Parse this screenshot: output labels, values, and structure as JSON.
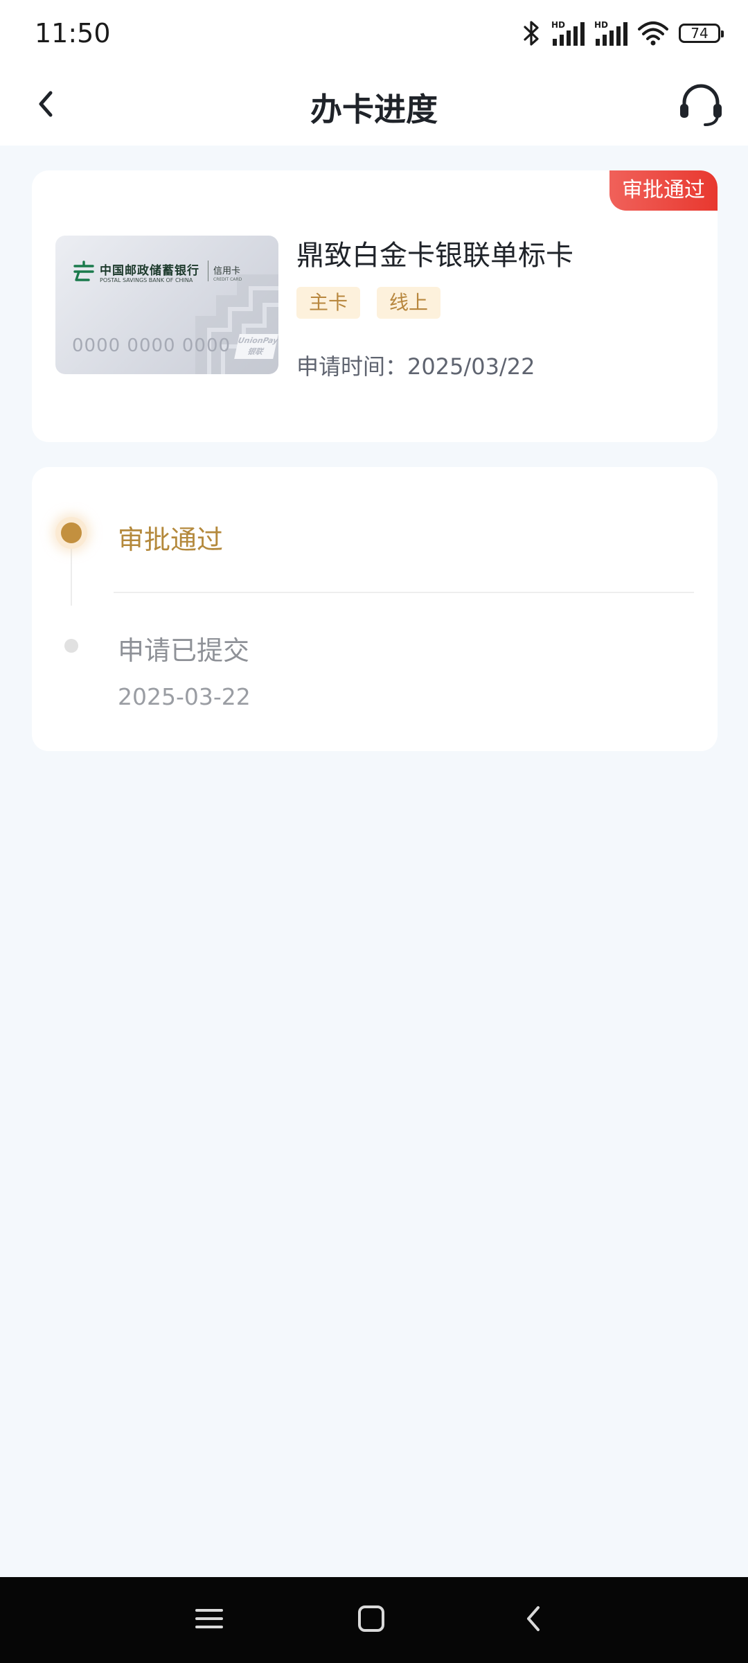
{
  "status_bar": {
    "time": "11:50",
    "battery": "74",
    "icons": [
      "bluetooth-icon",
      "hd-signal-icon",
      "hd-signal-icon",
      "wifi-icon",
      "battery-icon"
    ]
  },
  "header": {
    "title": "办卡进度",
    "back_icon": "chevron-left-icon",
    "service_icon": "headset-icon"
  },
  "card": {
    "status_badge": "审批通过",
    "image": {
      "bank_name": "中国邮政储蓄银行",
      "bank_name_en": "POSTAL SAVINGS BANK OF CHINA",
      "card_type": "信用卡",
      "card_type_en": "CREDIT CARD",
      "number": "0000 0000 0000",
      "network_logo": "UnionPay 银联"
    },
    "name": "鼎致白金卡银联单标卡",
    "tags": [
      "主卡",
      "线上"
    ],
    "apply_time": "申请时间：2025/03/22"
  },
  "progress": {
    "steps": [
      {
        "title": "审批通过",
        "date": "",
        "active": true
      },
      {
        "title": "申请已提交",
        "date": "2025-03-22",
        "active": false
      }
    ]
  },
  "colors": {
    "accent_gold": "#b4893c",
    "badge_red": "#e8382f",
    "tag_bg": "#fdf1dc",
    "page_bg": "#f4f8fc"
  },
  "nav_bar": {
    "icons": [
      "menu-icon",
      "home-icon",
      "back-icon"
    ]
  }
}
